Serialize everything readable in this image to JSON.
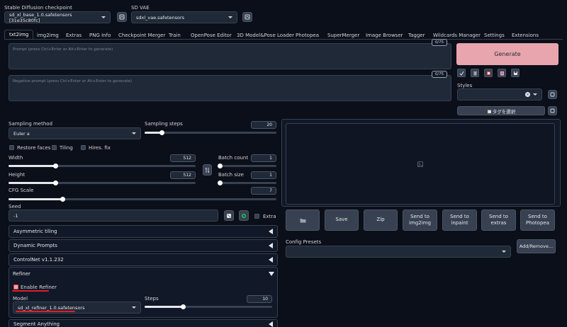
{
  "header": {
    "checkpoint_label": "Stable Diffusion checkpoint",
    "checkpoint_value": "sd_xl_base_1.0.safetensors [31e35c80fc]",
    "vae_label": "SD VAE",
    "vae_value": "sdxl_vae.safetensors"
  },
  "tabs": [
    {
      "label": "txt2img",
      "active": true
    },
    {
      "label": "img2img"
    },
    {
      "label": "Extras"
    },
    {
      "label": "PNG Info"
    },
    {
      "label": "Checkpoint Merger"
    },
    {
      "label": "Train"
    },
    {
      "label": "OpenPose Editor"
    },
    {
      "label": "3D Model&Pose Loader"
    },
    {
      "label": "Photopea"
    },
    {
      "label": "SuperMerger"
    },
    {
      "label": "Image Browser"
    },
    {
      "label": "Tagger"
    },
    {
      "label": "Wildcards Manager"
    },
    {
      "label": "Settings"
    },
    {
      "label": "Extensions"
    }
  ],
  "prompt": {
    "placeholder": "Prompt (press Ctrl+Enter or Alt+Enter to generate)",
    "counter": "0/75",
    "negative_placeholder": "Negative prompt (press Ctrl+Enter or Alt+Enter to generate)",
    "negative_counter": "0/75"
  },
  "generate": {
    "label": "Generate",
    "color": "#e8a5ad"
  },
  "styles": {
    "label": "Styles",
    "tag_button": "🔲タグを選択"
  },
  "sampling": {
    "method_label": "Sampling method",
    "method_value": "Euler a",
    "steps_label": "Sampling steps",
    "steps_value": "20",
    "steps_fraction": 0.13
  },
  "checkboxes": {
    "restore_faces": "Restore faces",
    "tiling": "Tiling",
    "hires_fix": "Hires. fix"
  },
  "dimensions": {
    "width_label": "Width",
    "width_value": "512",
    "width_fraction": 0.25,
    "height_label": "Height",
    "height_value": "512",
    "height_fraction": 0.25,
    "batch_count_label": "Batch count",
    "batch_count_value": "1",
    "batch_size_label": "Batch size",
    "batch_size_value": "1"
  },
  "cfg": {
    "label": "CFG Scale",
    "value": "7",
    "fraction": 0.2
  },
  "seed": {
    "label": "Seed",
    "value": "-1",
    "extra_label": "Extra"
  },
  "accordions": [
    {
      "label": "Asymmetric tiling",
      "open": false
    },
    {
      "label": "Dynamic Prompts",
      "open": false
    },
    {
      "label": "ControlNet v1.1.232",
      "open": false
    },
    {
      "label": "Refiner",
      "open": true
    }
  ],
  "refiner": {
    "enable_label": "Enable Refiner",
    "model_label": "Model",
    "model_value": "sd_xl_refiner_1.0.safetensors",
    "steps_label": "Steps",
    "steps_value": "10",
    "steps_fraction": 0.3
  },
  "bottom_accordion": "Segment Anything",
  "output_buttons": [
    {
      "label": "🗀",
      "name": "folder-button"
    },
    {
      "label": "Save",
      "name": "save-button"
    },
    {
      "label": "Zip",
      "name": "zip-button"
    },
    {
      "label": "Send to img2img",
      "name": "send-to-img2img-button"
    },
    {
      "label": "Send to inpaint",
      "name": "send-to-inpaint-button"
    },
    {
      "label": "Send to extras",
      "name": "send-to-extras-button"
    },
    {
      "label": "Send to Photopea",
      "name": "send-to-photopea-button"
    }
  ],
  "config_presets": {
    "label": "Config Presets",
    "button": "Add/Remove..."
  },
  "colors": {
    "background": "#0b0f19",
    "panel": "#1f2937",
    "accent_red": "#e11d2a",
    "generate": "#e8a5ad"
  }
}
